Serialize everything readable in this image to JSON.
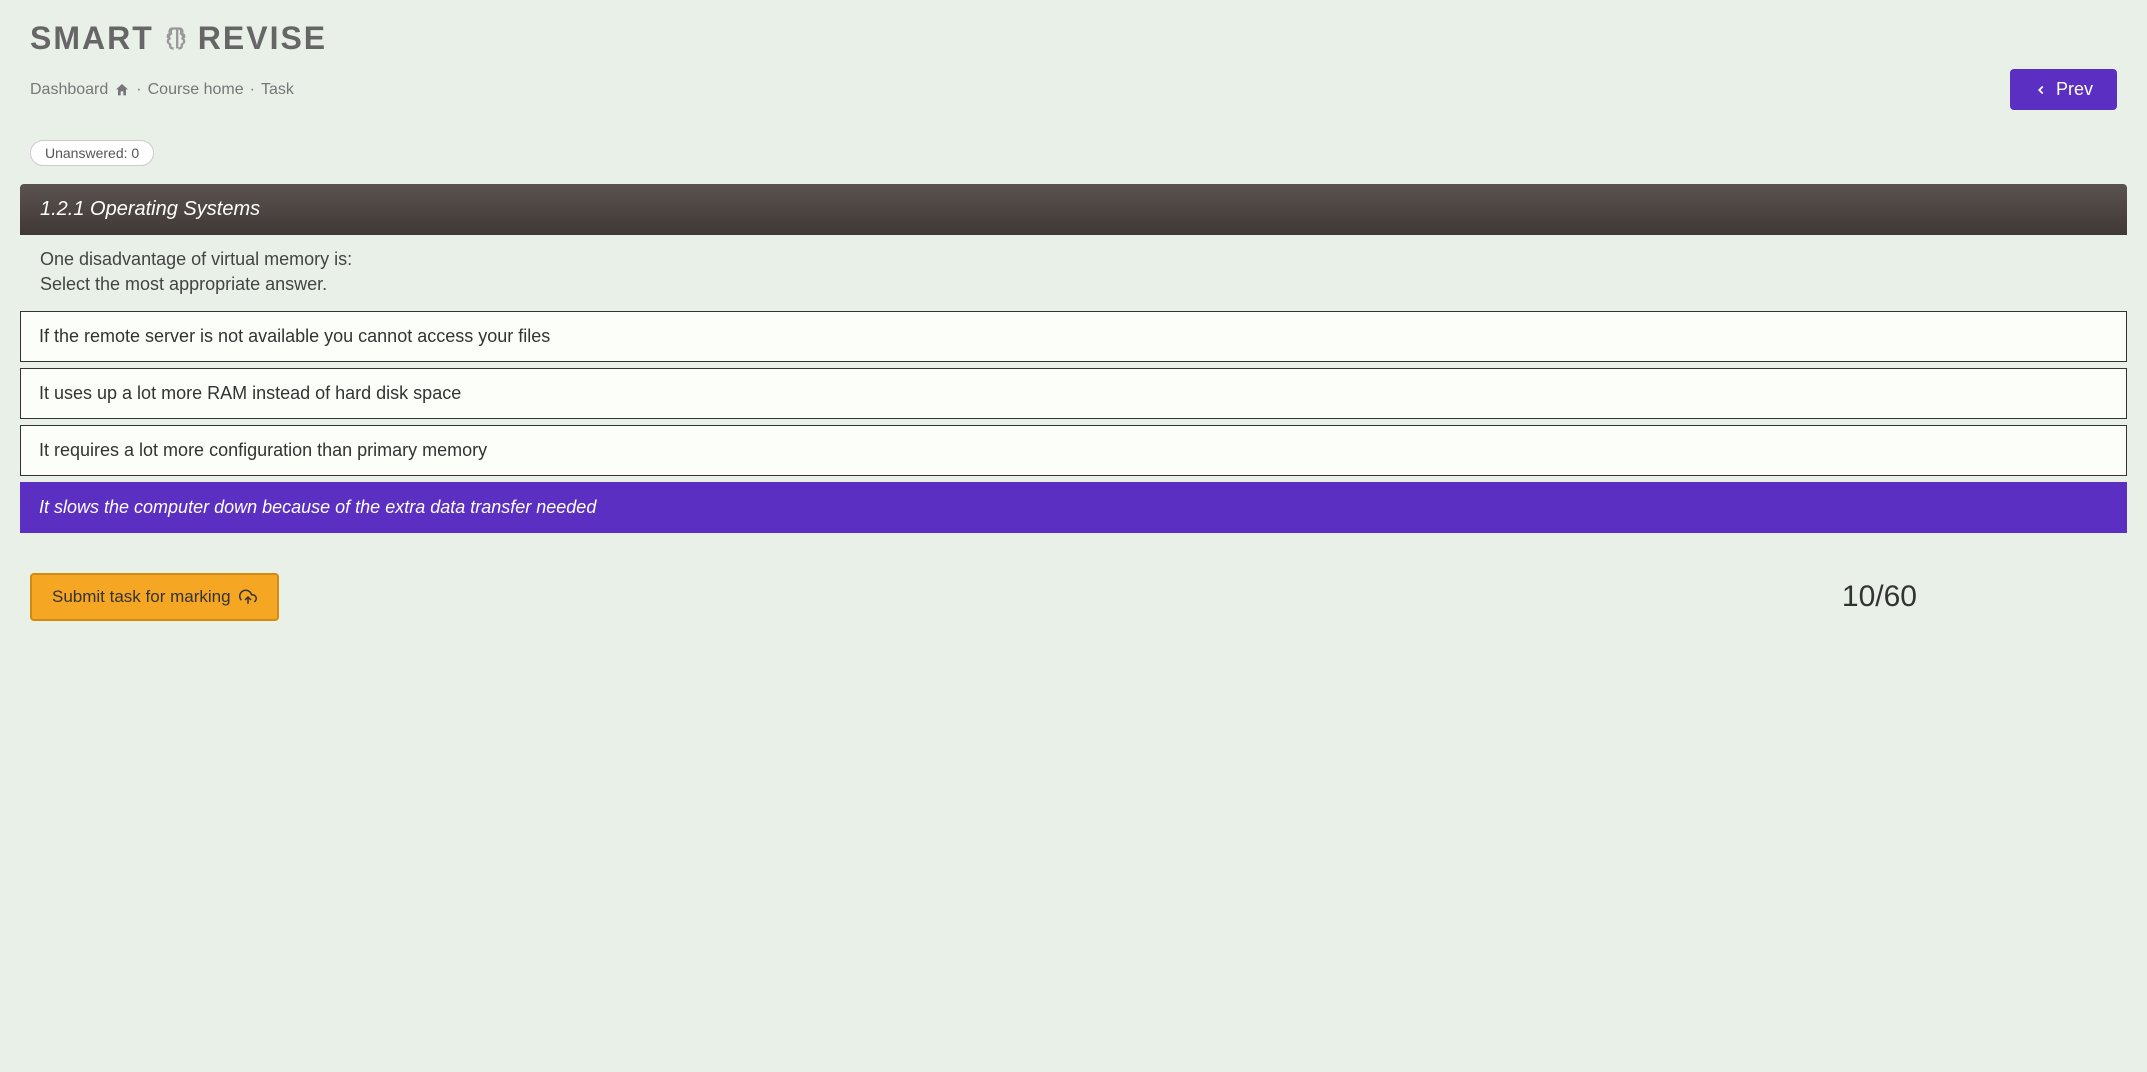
{
  "logo": {
    "part1": "SMART",
    "part2": "REVISE"
  },
  "breadcrumb": {
    "dashboard": "Dashboard",
    "course_home": "Course home",
    "task": "Task"
  },
  "nav": {
    "prev_label": "Prev"
  },
  "status": {
    "unanswered_label": "Unanswered: 0"
  },
  "topic": {
    "title": "1.2.1 Operating Systems"
  },
  "question": {
    "text": "One disadvantage of virtual memory is:",
    "instruction": "Select the most appropriate answer."
  },
  "options": [
    {
      "label": "If the remote server is not available you cannot access your files",
      "selected": false
    },
    {
      "label": "It uses up a lot more RAM instead of hard disk space",
      "selected": false
    },
    {
      "label": "It requires a lot more configuration than primary memory",
      "selected": false
    },
    {
      "label": "It slows the computer down because of the extra data transfer needed",
      "selected": true
    }
  ],
  "footer": {
    "submit_label": "Submit task for marking",
    "progress": "10/60"
  },
  "colors": {
    "accent": "#5a2fc2",
    "submit": "#f5a623",
    "topic_bg": "#4a433f"
  }
}
